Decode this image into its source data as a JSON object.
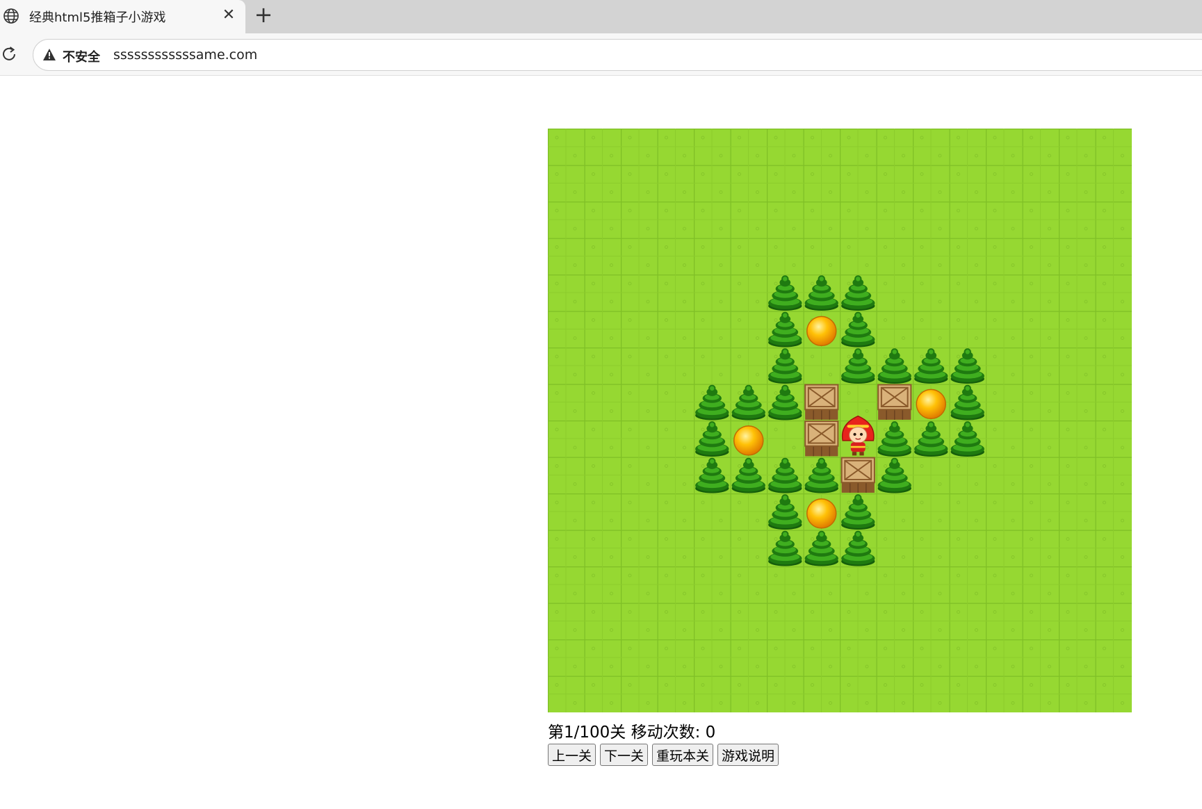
{
  "browser": {
    "tab_title": "经典html5推箱子小游戏",
    "close_glyph": "✕",
    "new_tab_glyph": "+",
    "security_label": "不安全",
    "url": "ssssssssssssame.com"
  },
  "game": {
    "grid_cols": 16,
    "grid_rows": 16,
    "colors": {
      "grass": "#96d832",
      "grass_line": "#7fbf26",
      "tree_dark": "#1f7a10",
      "tree_light": "#3fae1f",
      "crate": "#d9b27a",
      "crate_edge": "#8a5a2b",
      "target": "#ffb300"
    },
    "map": [
      "................",
      "................",
      "................",
      "................",
      "......TTT.......",
      "......TGT.......",
      "......T.TTTT....",
      "....TTTB.BGT....",
      "....TG.BPTTT....",
      "....TTTTBT......",
      "......TGT.......",
      "......TTT.......",
      "................",
      "................",
      "................",
      "................"
    ],
    "legend": {
      "T": "tree-wall",
      "G": "goal",
      "B": "box",
      "P": "player",
      ".": "grass"
    }
  },
  "status": {
    "text": "第1/100关 移动次数: 0"
  },
  "buttons": {
    "prev": "上一关",
    "next": "下一关",
    "restart": "重玩本关",
    "help": "游戏说明"
  }
}
